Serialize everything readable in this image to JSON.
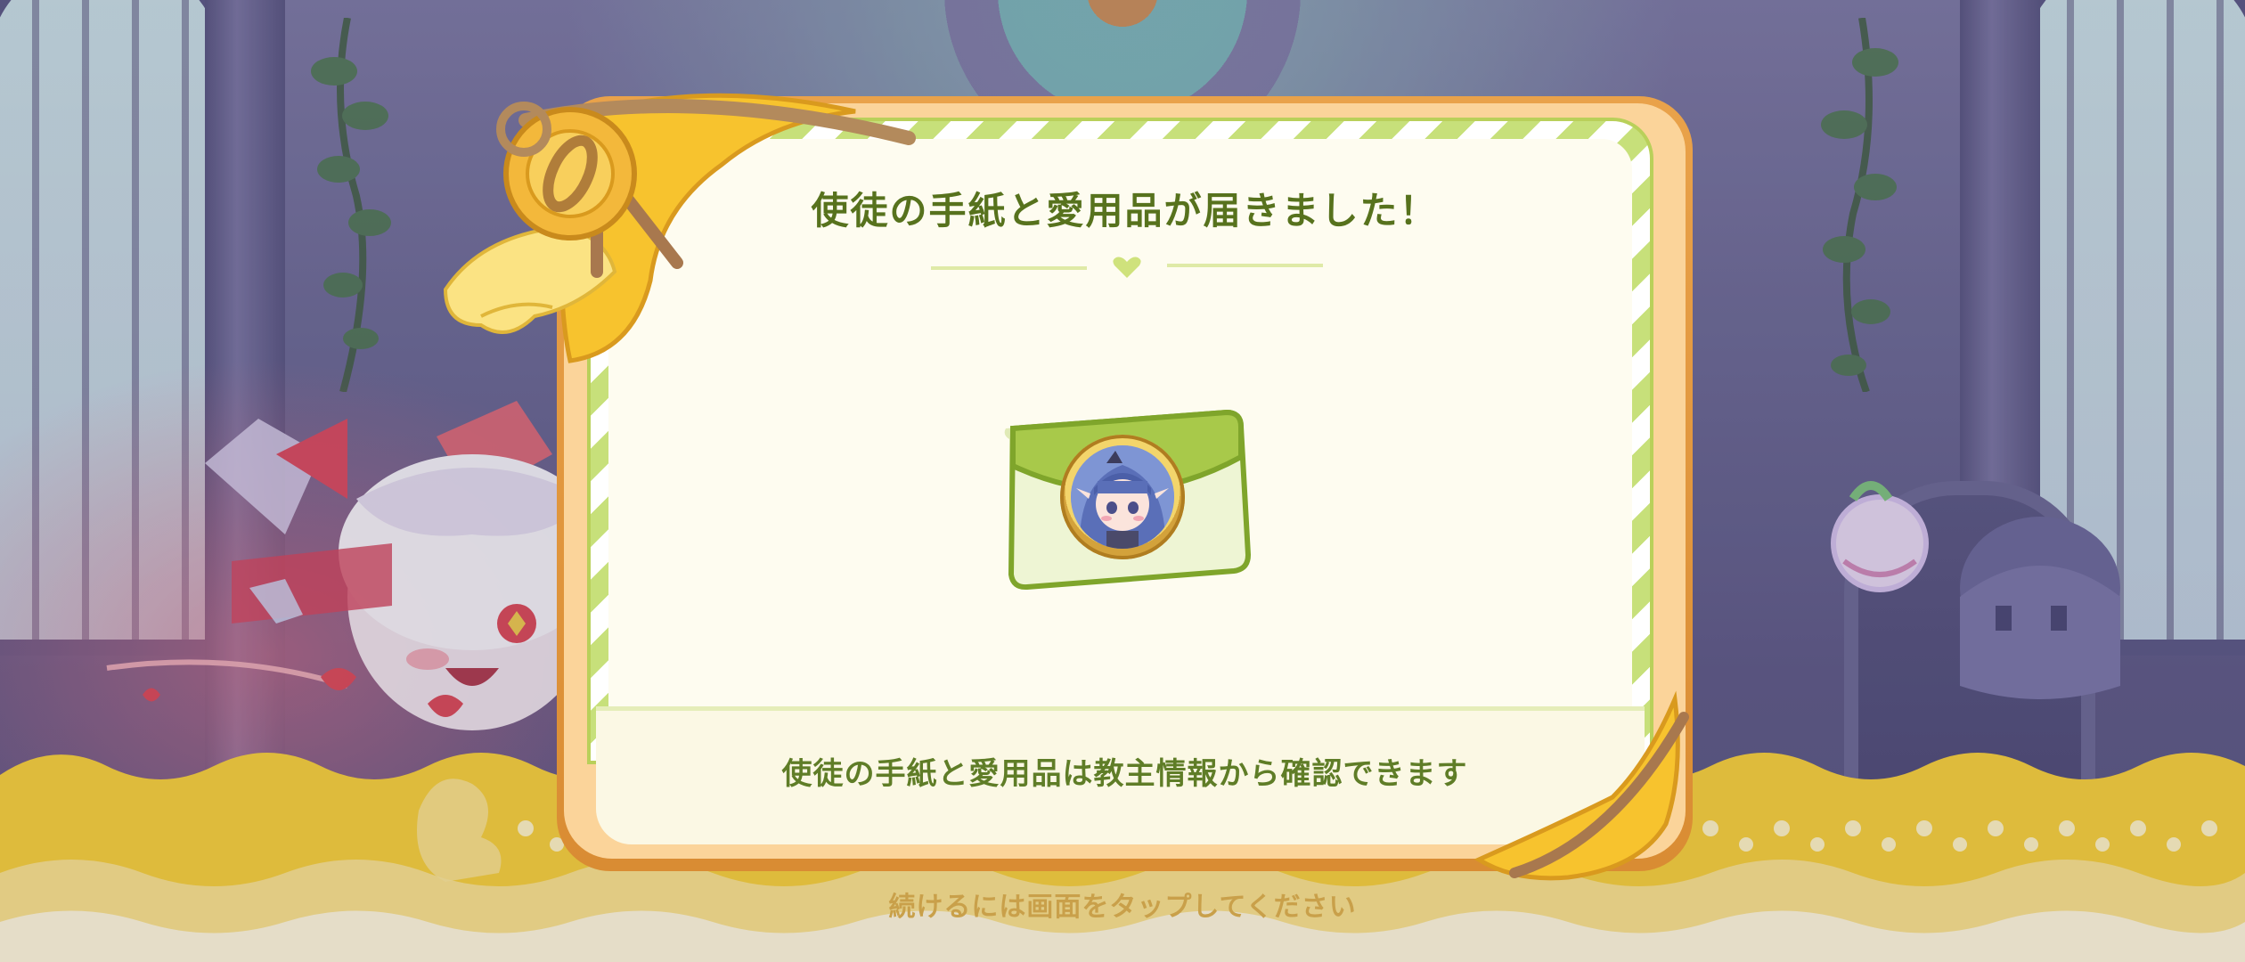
{
  "dialog": {
    "title": "使徒の手紙と愛用品が届きました！",
    "message": "使徒の手紙と愛用品は教主情報から確認できます"
  },
  "footer": {
    "tap_hint": "続けるには画面をタップしてください"
  },
  "icons": {
    "envelope": "envelope-icon",
    "portrait": "character-portrait",
    "heart": "heart-icon"
  },
  "colors": {
    "accent_green": "#57721d",
    "frame_orange": "#e9a24a",
    "paper": "#fefcf0",
    "stripe_green": "#c7e07a",
    "band_yellow": "#f7d13b",
    "hint_gold": "#c9a04a"
  }
}
